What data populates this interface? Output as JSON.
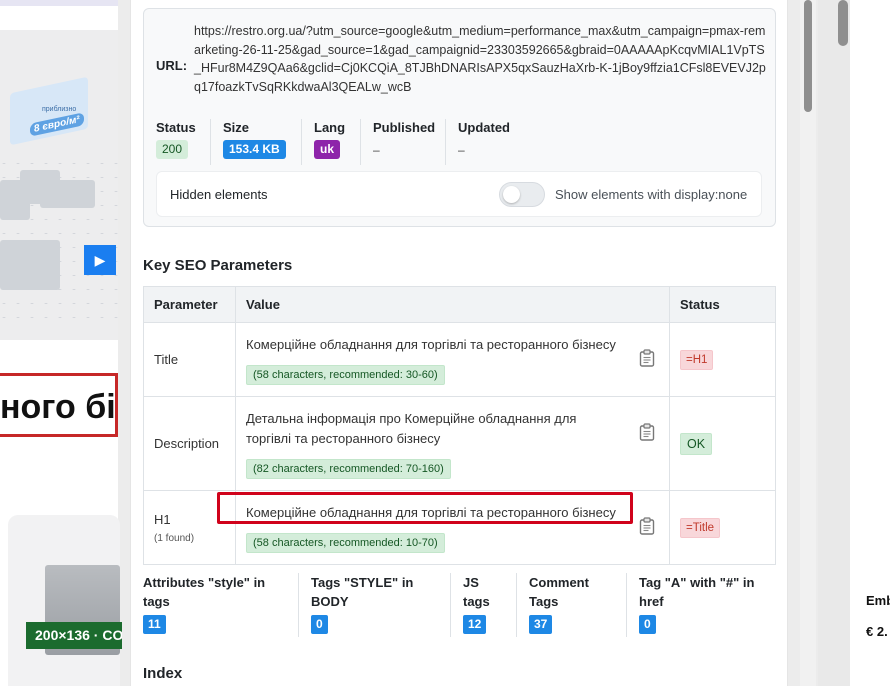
{
  "background": {
    "hero_price": "8 євро/м²",
    "hero_pretext": "приблизно",
    "heading_fragment": "ного бі",
    "size_badge": "200×136 · CO",
    "right_text_1": "Emb",
    "right_text_2": "€ 2."
  },
  "page_info": {
    "url_label": "URL:",
    "url": "https://restro.org.ua/?utm_source=google&utm_medium=performance_max&utm_campaign=pmax-remarketing-26-11-25&gad_source=1&gad_campaignid=23303592665&gbraid=0AAAAApKcqvMIAL1VpTS_HFur8M4Z9QAa6&gclid=Cj0KCQiA_8TJBhDNARIsAPX5qxSauzHaXrb-K-1jBoy9ffzia1CFsl8EVEVJ2pq17foazkTvSqRKkdwaAl3QEALw_wcB",
    "status": {
      "label": "Status",
      "value": "200"
    },
    "size": {
      "label": "Size",
      "value": "153.4 KB"
    },
    "lang": {
      "label": "Lang",
      "value": "uk"
    },
    "published": {
      "label": "Published",
      "value": "–"
    },
    "updated": {
      "label": "Updated",
      "value": "–"
    },
    "hidden": {
      "label": "Hidden elements",
      "toggle_label": "Show elements with display:none",
      "toggle_on": false
    }
  },
  "seo": {
    "title": "Key SEO Parameters",
    "columns": [
      "Parameter",
      "Value",
      "Status"
    ],
    "rows": [
      {
        "param": "Title",
        "value": "Комерційне обладнання для торгівлі та ресторанного бізнесу",
        "info": "(58 characters, recommended: 30-60)",
        "status": "=H1"
      },
      {
        "param": "Description",
        "value": "Детальна інформація про Комерційне обладнання для торгівлі та ресторанного бізнесу",
        "info": "(82 characters, recommended: 70-160)",
        "status": "OK"
      },
      {
        "param": "H1",
        "param_note": "(1 found)",
        "value": "Комерційне обладнання для торгівлі та ресторанного бізнесу",
        "info": "(58 characters, recommended: 10-70)",
        "status": "=Title"
      }
    ]
  },
  "stats": [
    {
      "label": "Attributes \"style\" in tags",
      "value": "11"
    },
    {
      "label": "Tags \"STYLE\" in BODY",
      "value": "0"
    },
    {
      "label": "JS tags",
      "value": "12"
    },
    {
      "label": "Comment Tags",
      "value": "37"
    },
    {
      "label": "Tag \"A\" with \"#\" in href",
      "value": "0"
    }
  ],
  "index_title": "Index",
  "colors": {
    "accent": "#1e88e5",
    "lang_badge": "#8e24aa",
    "ok_bg": "#d4edda",
    "bad_bg": "#f8d7da",
    "highlight": "#d0021b"
  }
}
